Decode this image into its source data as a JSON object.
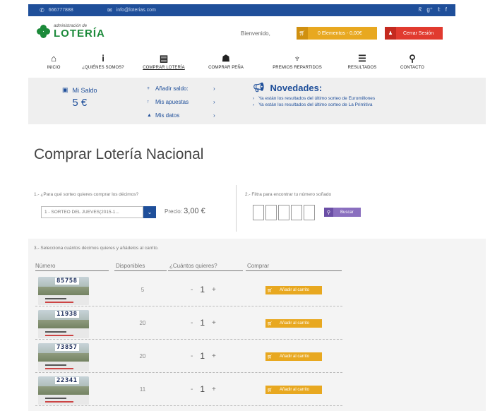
{
  "topbar": {
    "phone": "666777888",
    "email": "info@loterias.com",
    "social": [
      "rss",
      "g+",
      "twitter",
      "facebook"
    ]
  },
  "header": {
    "logo_small": "administración de",
    "logo_big": "LOTERÍA",
    "welcome": "Bienvenido,",
    "cart_label": "0 Elementos - 0,00€",
    "logout_label": "Cerrar Sesión"
  },
  "nav": {
    "items": [
      {
        "label": "INICIO",
        "icon": "home-icon"
      },
      {
        "label": "¿QUIÉNES SOMOS?",
        "icon": "info-icon"
      },
      {
        "label": "COMPRAR LOTERÍA",
        "icon": "ticket-icon"
      },
      {
        "label": "COMPRAR PEÑA",
        "icon": "group-icon"
      },
      {
        "label": "PREMIOS REPARTIDOS",
        "icon": "trophy-icon"
      },
      {
        "label": "RESULTADOS",
        "icon": "list-icon"
      },
      {
        "label": "CONTACTO",
        "icon": "location-pin-icon"
      }
    ]
  },
  "account": {
    "saldo_label": "Mi Saldo",
    "saldo_value": "5 €",
    "menu": [
      {
        "icon": "+",
        "label": "Añadir saldo:"
      },
      {
        "icon": "↑",
        "label": "Mis apuestas"
      },
      {
        "icon": "▲",
        "label": "Mis datos"
      }
    ]
  },
  "novedades": {
    "title": "Novedades:",
    "items": [
      "Ya están los resultados del último sorteo de Euromillones",
      "Ya están los resultados del último sorteo de La Primitiva"
    ]
  },
  "page": {
    "title": "Comprar Lotería Nacional"
  },
  "step1": {
    "label": "1.- ¿Para qué sorteo quieres comprar los décimos?",
    "selected": "1 - SORTEO DEL JUEVES(2015-1...",
    "price_label": "Precio:",
    "price_value": "3,00 €"
  },
  "step2": {
    "label": "2.- Filtra para encontrar tu número soñado",
    "button": "Buscar"
  },
  "step3": {
    "label": "3.- Selecciona cuántos décimos quieres y añádelos al carrito.",
    "headers": {
      "numero": "Número",
      "disponibles": "Disponibles",
      "cuantos": "¿Cuántos quieres?",
      "comprar": "Comprar"
    },
    "rows": [
      {
        "number": "85758",
        "available": "5",
        "qty": "1",
        "add_label": "Añadir al carrito"
      },
      {
        "number": "11938",
        "available": "20",
        "qty": "1",
        "add_label": "Añadir al carrito"
      },
      {
        "number": "73857",
        "available": "20",
        "qty": "1",
        "add_label": "Añadir al carrito"
      },
      {
        "number": "22341",
        "available": "11",
        "qty": "1",
        "add_label": "Añadir al carrito"
      }
    ]
  },
  "colors": {
    "brand_blue": "#1f4f9a",
    "brand_green": "#1c8a3a",
    "cart_yellow": "#e8a820",
    "logout_red": "#e13a2f",
    "search_purple": "#8a6fbf"
  }
}
